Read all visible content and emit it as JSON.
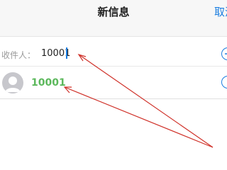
{
  "nav": {
    "title": "新信息",
    "cancel_label": "取消"
  },
  "recipient": {
    "label": "收件人：",
    "value": "10001"
  },
  "suggestion": {
    "number": "10001"
  },
  "colors": {
    "accent": "#1a7de0",
    "suggestion_text": "#5cb85c",
    "annotation_arrow": "#d0332b"
  }
}
